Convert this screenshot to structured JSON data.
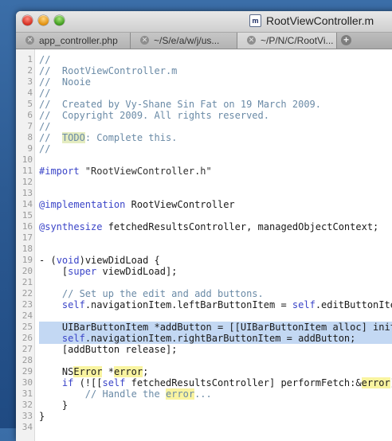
{
  "window": {
    "title": "RootViewController.m",
    "doc_icon_letter": "m"
  },
  "tabs": [
    {
      "label": "app_controller.php",
      "active": false
    },
    {
      "label": "~/S/e/a/w/j/us...",
      "active": false
    },
    {
      "label": "~/P/N/C/RootVi...",
      "active": true
    }
  ],
  "tab_close_glyph": "✕",
  "add_tab_glyph": "+",
  "selection_color": "#c3d8f3",
  "highlight_color": "#f9f4a0",
  "lines": [
    {
      "n": "1",
      "segs": [
        {
          "t": "//",
          "c": "comment"
        }
      ]
    },
    {
      "n": "2",
      "segs": [
        {
          "t": "//  RootViewController.m",
          "c": "comment"
        }
      ]
    },
    {
      "n": "3",
      "segs": [
        {
          "t": "//  Nooie",
          "c": "comment"
        }
      ]
    },
    {
      "n": "4",
      "segs": [
        {
          "t": "//",
          "c": "comment"
        }
      ]
    },
    {
      "n": "5",
      "segs": [
        {
          "t": "//  Created by Vy-Shane Sin Fat on 19 March 2009.",
          "c": "comment"
        }
      ]
    },
    {
      "n": "6",
      "segs": [
        {
          "t": "//  Copyright 2009. All rights reserved.",
          "c": "comment"
        }
      ]
    },
    {
      "n": "7",
      "segs": [
        {
          "t": "//",
          "c": "comment"
        }
      ]
    },
    {
      "n": "8",
      "segs": [
        {
          "t": "//  ",
          "c": "comment"
        },
        {
          "t": "TODO",
          "c": "comment tag"
        },
        {
          "t": ": Complete this.",
          "c": "comment"
        }
      ]
    },
    {
      "n": "9",
      "segs": [
        {
          "t": "//",
          "c": "comment"
        }
      ]
    },
    {
      "n": "10",
      "segs": []
    },
    {
      "n": "11",
      "segs": [
        {
          "t": "#import ",
          "c": "pre"
        },
        {
          "t": "\"RootViewController.h\"",
          "c": "string"
        }
      ]
    },
    {
      "n": "12",
      "segs": []
    },
    {
      "n": "13",
      "segs": []
    },
    {
      "n": "14",
      "segs": [
        {
          "t": "@implementation",
          "c": "keyword"
        },
        {
          "t": " RootViewController",
          "c": ""
        }
      ]
    },
    {
      "n": "15",
      "segs": []
    },
    {
      "n": "16",
      "segs": [
        {
          "t": "@synthesize",
          "c": "keyword"
        },
        {
          "t": " fetchedResultsController, managedObjectContext;",
          "c": ""
        }
      ]
    },
    {
      "n": "17",
      "segs": []
    },
    {
      "n": "18",
      "segs": []
    },
    {
      "n": "19",
      "segs": [
        {
          "t": "- (",
          "c": ""
        },
        {
          "t": "void",
          "c": "keyword"
        },
        {
          "t": ")viewDidLoad {",
          "c": ""
        }
      ]
    },
    {
      "n": "20",
      "segs": [
        {
          "t": "    [",
          "c": ""
        },
        {
          "t": "super",
          "c": "keyword"
        },
        {
          "t": " viewDidLoad];",
          "c": ""
        }
      ]
    },
    {
      "n": "21",
      "segs": []
    },
    {
      "n": "22",
      "segs": [
        {
          "t": "    // Set up the edit and add buttons.",
          "c": "comment"
        }
      ]
    },
    {
      "n": "23",
      "segs": [
        {
          "t": "    ",
          "c": ""
        },
        {
          "t": "self",
          "c": "keyword"
        },
        {
          "t": ".navigationItem.leftBarButtonItem = ",
          "c": ""
        },
        {
          "t": "self",
          "c": "keyword"
        },
        {
          "t": ".editButtonItem;",
          "c": ""
        }
      ]
    },
    {
      "n": "24",
      "segs": []
    },
    {
      "n": "25",
      "sel": true,
      "segs": [
        {
          "t": "    UIBarButtonItem *addButton = [[UIBarButtonItem alloc] initWithBarButtonSystemItem:",
          "c": ""
        }
      ]
    },
    {
      "n": "26",
      "sel": true,
      "segs": [
        {
          "t": "    ",
          "c": ""
        },
        {
          "t": "self",
          "c": "keyword"
        },
        {
          "t": ".navigationItem.rightBarButtonItem = addButton;",
          "c": ""
        }
      ]
    },
    {
      "n": "27",
      "segs": [
        {
          "t": "    [addButton release];",
          "c": ""
        }
      ]
    },
    {
      "n": "28",
      "segs": []
    },
    {
      "n": "29",
      "segs": [
        {
          "t": "    NS",
          "c": ""
        },
        {
          "t": "Error",
          "c": "hl"
        },
        {
          "t": " *",
          "c": ""
        },
        {
          "t": "error",
          "c": "hl"
        },
        {
          "t": ";",
          "c": ""
        }
      ]
    },
    {
      "n": "30",
      "segs": [
        {
          "t": "    ",
          "c": ""
        },
        {
          "t": "if",
          "c": "keyword"
        },
        {
          "t": " (![[",
          "c": ""
        },
        {
          "t": "self",
          "c": "keyword"
        },
        {
          "t": " fetchedResultsController] performFetch:&",
          "c": ""
        },
        {
          "t": "error",
          "c": "hl"
        },
        {
          "t": "]) {",
          "c": ""
        }
      ]
    },
    {
      "n": "31",
      "segs": [
        {
          "t": "        // Handle the ",
          "c": "comment"
        },
        {
          "t": "error",
          "c": "comment hl"
        },
        {
          "t": "...",
          "c": "comment"
        }
      ]
    },
    {
      "n": "32",
      "segs": [
        {
          "t": "    }",
          "c": ""
        }
      ]
    },
    {
      "n": "33",
      "segs": [
        {
          "t": "}",
          "c": ""
        }
      ]
    },
    {
      "n": "34",
      "segs": []
    }
  ]
}
